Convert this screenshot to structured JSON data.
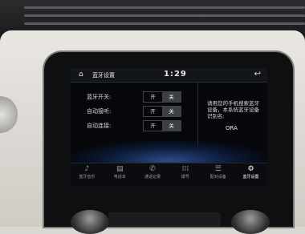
{
  "status_bar": {
    "home_icon": "home-icon",
    "title": "蓝牙设置",
    "time": "1:29",
    "back_icon": "back-icon"
  },
  "settings": [
    {
      "label": "蓝牙开关:",
      "on": "开",
      "off": "关",
      "selected": "关"
    },
    {
      "label": "自动接听:",
      "on": "开",
      "off": "关",
      "selected": "关"
    },
    {
      "label": "自动连接:",
      "on": "开",
      "off": "关",
      "selected": "关"
    }
  ],
  "info": {
    "text": "请用您的手机搜索蓝牙设备，本系统蓝牙设备识别名:",
    "device_name": "ORA"
  },
  "nav": [
    {
      "label": "蓝牙音乐",
      "icon": "music-note-icon"
    },
    {
      "label": "电话本",
      "icon": "phonebook-icon"
    },
    {
      "label": "通话记录",
      "icon": "call-log-icon"
    },
    {
      "label": "拨号",
      "icon": "dialpad-icon"
    },
    {
      "label": "配对设备",
      "icon": "paired-devices-icon"
    },
    {
      "label": "蓝牙设置",
      "icon": "gear-icon",
      "active": true
    }
  ]
}
